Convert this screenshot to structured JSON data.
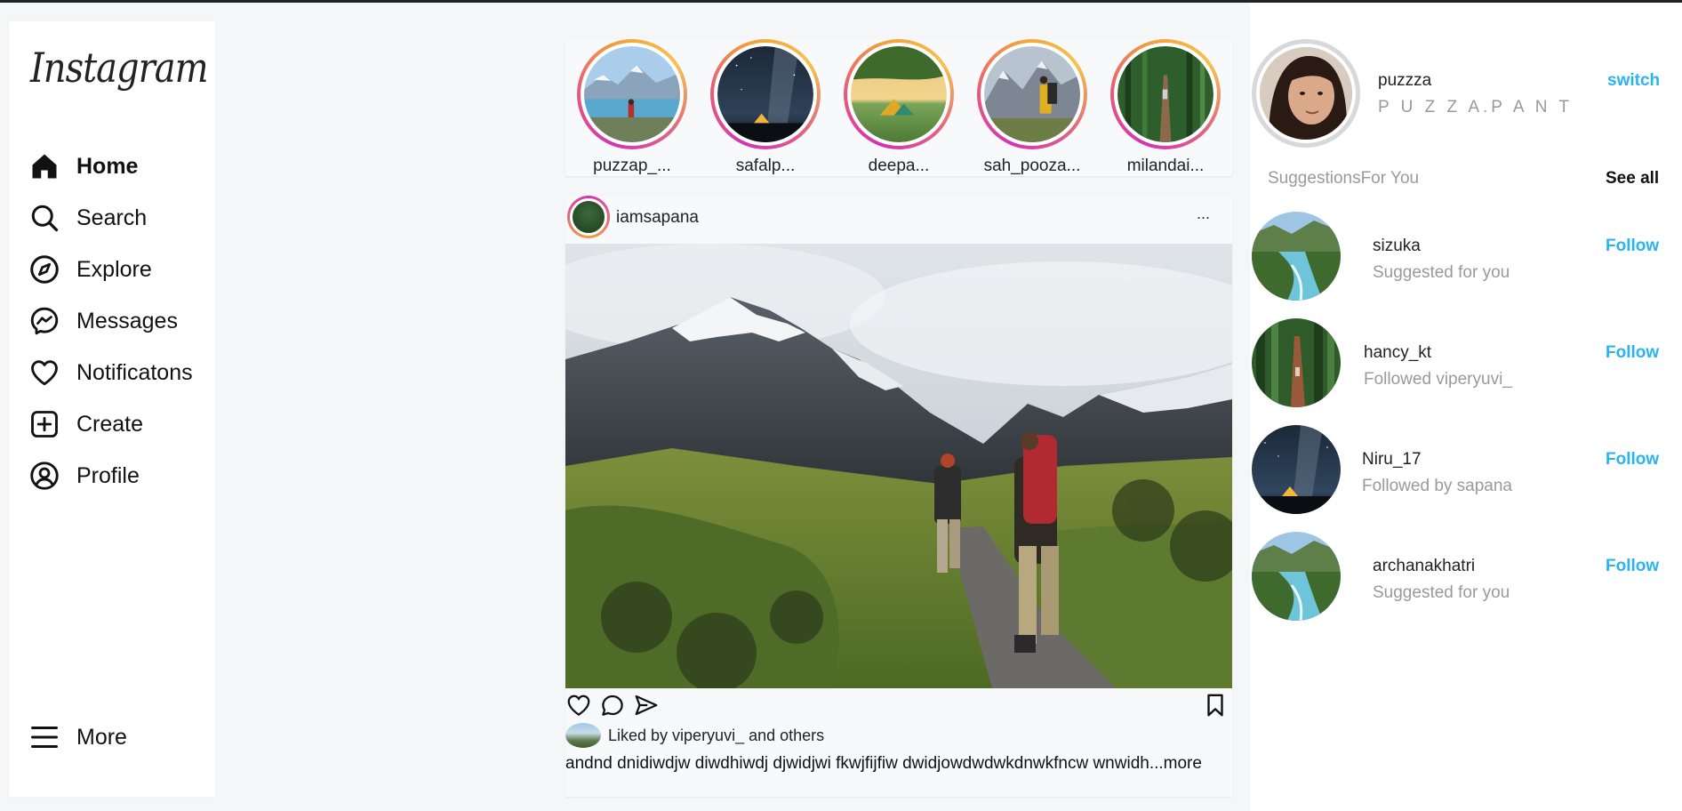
{
  "app": {
    "logo": "Instagram"
  },
  "sidebar": {
    "items": [
      {
        "label": "Home",
        "icon": "home-icon"
      },
      {
        "label": "Search",
        "icon": "search-icon"
      },
      {
        "label": "Explore",
        "icon": "compass-icon"
      },
      {
        "label": "Messages",
        "icon": "messenger-icon"
      },
      {
        "label": "Notificatons",
        "icon": "heart-icon"
      },
      {
        "label": "Create",
        "icon": "plus-square-icon"
      },
      {
        "label": "Profile",
        "icon": "user-circle-icon"
      }
    ],
    "more": {
      "label": "More",
      "icon": "menu-icon"
    }
  },
  "stories": [
    {
      "name": "puzzap_..."
    },
    {
      "name": "safalp..."
    },
    {
      "name": "deepa..."
    },
    {
      "name": "sah_pooza..."
    },
    {
      "name": "milandai..."
    }
  ],
  "post": {
    "username": "iamsapana",
    "more": "...",
    "liked_by": "Liked by viperyuvi_ and others",
    "caption": "andnd dnidiwdjw diwdhiwdj djwidjwi fkwjfijfiw dwidjowdwdwkdnwkfncw wnwidh",
    "caption_more": "...more",
    "actions": [
      "heart-icon",
      "comment-icon",
      "share-icon",
      "bookmark-icon"
    ]
  },
  "me": {
    "username": "puzzza",
    "fullname": "P U Z Z A.P A N T",
    "switch_label": "switch"
  },
  "suggestions": {
    "title": "SuggestionsFor You",
    "see_all": "See all",
    "follow_label": "Follow",
    "items": [
      {
        "name": "sizuka",
        "sub": "Suggested for you"
      },
      {
        "name": "hancy_kt",
        "sub": "Followed viperyuvi_"
      },
      {
        "name": "Niru_17",
        "sub": "Followed by sapana"
      },
      {
        "name": "archanakhatri",
        "sub": "Suggested for you"
      }
    ]
  },
  "colors": {
    "accent": "#2bb3f1",
    "muted": "#9a9a9a",
    "ring_start": "#d433b5",
    "ring_end": "#f2a13c"
  }
}
